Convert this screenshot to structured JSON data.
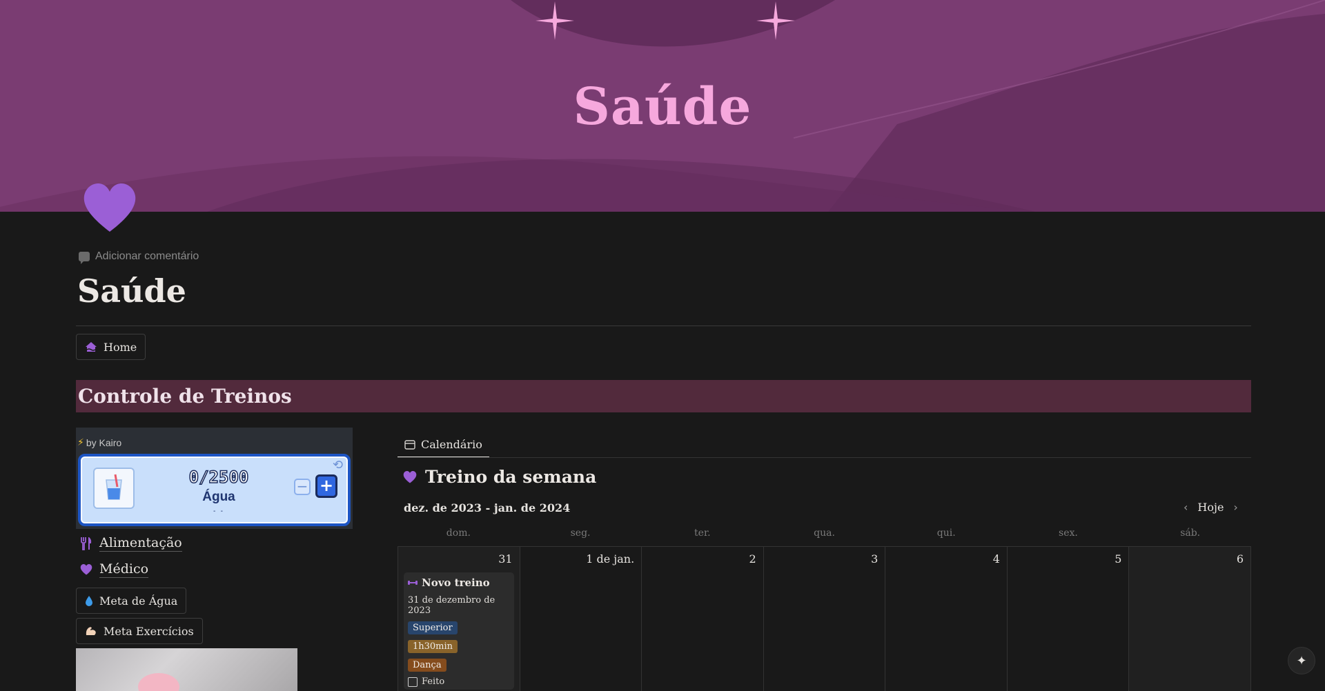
{
  "banner": {
    "title": "Saúde",
    "color": "#7a3c72",
    "title_color": "#f6a8dd"
  },
  "page": {
    "icon": "purple-heart-icon",
    "add_comment": "Adicionar comentário",
    "title": "Saúde"
  },
  "nav": {
    "home_label": "Home"
  },
  "section": {
    "title": "Controle de Treinos",
    "bg": "#522a3c"
  },
  "water_widget": {
    "by": "by Kairo",
    "count": "0/2500",
    "label": "Água",
    "dots": "- -",
    "minus": "−",
    "plus": "+"
  },
  "links": [
    {
      "label": "Alimentação",
      "icon": "fork-knife-icon"
    },
    {
      "label": "Médico",
      "icon": "heart-icon"
    }
  ],
  "goal_buttons": {
    "water": "Meta de Água",
    "exercise": "Meta Exercícios"
  },
  "calendar": {
    "tab_label": "Calendário",
    "title": "Treino da semana",
    "range": "dez. de 2023 - jan. de 2024",
    "today": "Hoje",
    "weekdays": [
      "dom.",
      "seg.",
      "ter.",
      "qua.",
      "qui.",
      "sex.",
      "sáb."
    ],
    "days": [
      "31",
      "1 de jan.",
      "2",
      "3",
      "4",
      "5",
      "6"
    ],
    "event": {
      "title": "Novo treino",
      "date": "31 de dezembro de 2023",
      "tags": [
        "Superior",
        "1h30min",
        "Dança"
      ],
      "checkbox_label": "Feito"
    }
  }
}
